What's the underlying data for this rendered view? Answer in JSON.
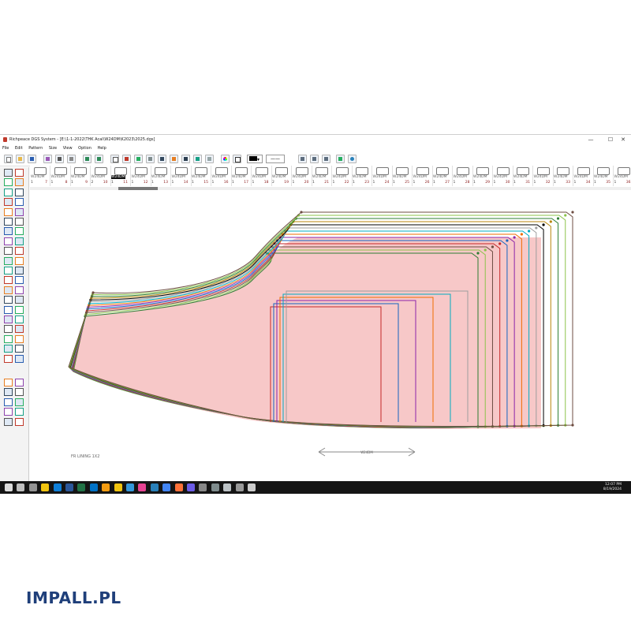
{
  "window": {
    "title": "Richpeace DGS System - [E:\\1-1-2022\\THK Acal\\W24DM\\K2023\\2025.dgs]",
    "controls": [
      "—",
      "☐",
      "✕"
    ]
  },
  "menu": [
    "File",
    "Edit",
    "Pattern",
    "Size",
    "View",
    "Option",
    "Help"
  ],
  "toolbar": {
    "line_width_value": "——",
    "colors": {
      "toolbar_bg": "#eef3f9",
      "accent": "#1c5fbf"
    }
  },
  "pieces": [
    {
      "label": "W24DM",
      "num": "1",
      "n": "7"
    },
    {
      "label": "W24DM",
      "num": "1",
      "n": "8"
    },
    {
      "label": "W24DM",
      "num": "1",
      "n": "9"
    },
    {
      "label": "W24DM",
      "num": "2",
      "n": "10"
    },
    {
      "label": "W24DM",
      "num": "1",
      "n": "11",
      "selected": true
    },
    {
      "label": "W24DM",
      "num": "1",
      "n": "12"
    },
    {
      "label": "W24DM",
      "num": "1",
      "n": "13"
    },
    {
      "label": "W24DM",
      "num": "1",
      "n": "14"
    },
    {
      "label": "W24DM",
      "num": "1",
      "n": "15"
    },
    {
      "label": "W24DM",
      "num": "1",
      "n": "16"
    },
    {
      "label": "W24DM",
      "num": "1",
      "n": "17"
    },
    {
      "label": "W24DM",
      "num": "1",
      "n": "18"
    },
    {
      "label": "W24DM",
      "num": "2",
      "n": "19"
    },
    {
      "label": "W24DM",
      "num": "1",
      "n": "20"
    },
    {
      "label": "W24DM",
      "num": "1",
      "n": "21"
    },
    {
      "label": "W24DM",
      "num": "1",
      "n": "22"
    },
    {
      "label": "W24DM",
      "num": "1",
      "n": "23"
    },
    {
      "label": "W24DM",
      "num": "1",
      "n": "24"
    },
    {
      "label": "W24DM",
      "num": "1",
      "n": "25"
    },
    {
      "label": "W24DM",
      "num": "1",
      "n": "26"
    },
    {
      "label": "W24DM",
      "num": "1",
      "n": "27"
    },
    {
      "label": "W24DM",
      "num": "1",
      "n": "28"
    },
    {
      "label": "W24DM",
      "num": "1",
      "n": "29"
    },
    {
      "label": "W24DM",
      "num": "1",
      "n": "30"
    },
    {
      "label": "W24DM",
      "num": "1",
      "n": "31"
    },
    {
      "label": "W24DM",
      "num": "1",
      "n": "32"
    },
    {
      "label": "W24DM",
      "num": "1",
      "n": "33"
    },
    {
      "label": "W24DM",
      "num": "1",
      "n": "34"
    },
    {
      "label": "W24DM",
      "num": "1",
      "n": "35"
    },
    {
      "label": "W24DM",
      "num": "1",
      "n": "36"
    }
  ],
  "canvas": {
    "piece_caption": "FR LINING 1X2",
    "grainline_label": "W24DM",
    "fill_color": "#f7c8c8",
    "outline_colors": [
      "#2e7d32",
      "#8bc34a",
      "#6d4c41",
      "#c62828",
      "#1565c0",
      "#8e24aa",
      "#ef6c00",
      "#00acc1",
      "#9e9e9e",
      "#000000",
      "#b8860b"
    ]
  },
  "taskbar": {
    "time": "12:07 PM",
    "date": "8/19/2024",
    "apps": [
      "windows",
      "search",
      "task-view",
      "explorer",
      "edge",
      "word",
      "excel",
      "outlook",
      "files",
      "sticky",
      "mail",
      "paint",
      "photos",
      "chrome",
      "firefox",
      "snip",
      "app1",
      "app2",
      "dgs",
      "app3",
      "app4"
    ]
  },
  "brand": "IMPALL.PL"
}
